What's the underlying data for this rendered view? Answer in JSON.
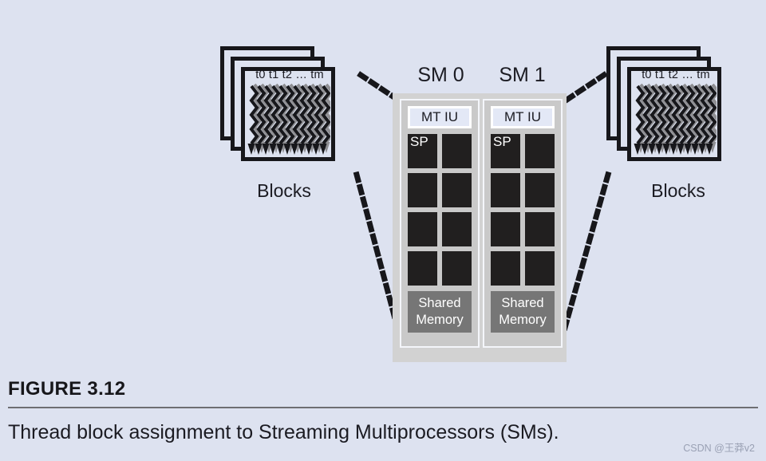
{
  "figure": {
    "title": "FIGURE 3.12",
    "caption": "Thread block assignment to Streaming Multiprocessors (SMs)."
  },
  "watermark": "CSDN @王莽v2",
  "colors": {
    "page_background": "#dde2f0",
    "chip_container": "#d2d2d2",
    "sm_panel": "#c9c9c9",
    "sp_block": "#211f1f",
    "shared_memory": "#767676",
    "mtiu_fill": "#e3e8f6",
    "outline": "#17171b"
  },
  "block_stacks": [
    {
      "side": "left",
      "threads_label": "t0 t1 t2 … tm",
      "caption": "Blocks",
      "sheet_count": 3
    },
    {
      "side": "right",
      "threads_label": "t0 t1 t2 … tm",
      "caption": "Blocks",
      "sheet_count": 3
    }
  ],
  "streaming_multiprocessors": [
    {
      "label": "SM 0",
      "instruction_unit": "MT IU",
      "sp_label": "SP",
      "sp_count": 8,
      "shared_memory_line1": "Shared",
      "shared_memory_line2": "Memory"
    },
    {
      "label": "SM 1",
      "instruction_unit": "MT IU",
      "sp_label": "SP",
      "sp_count": 8,
      "shared_memory_line1": "Shared",
      "shared_memory_line2": "Memory"
    }
  ]
}
